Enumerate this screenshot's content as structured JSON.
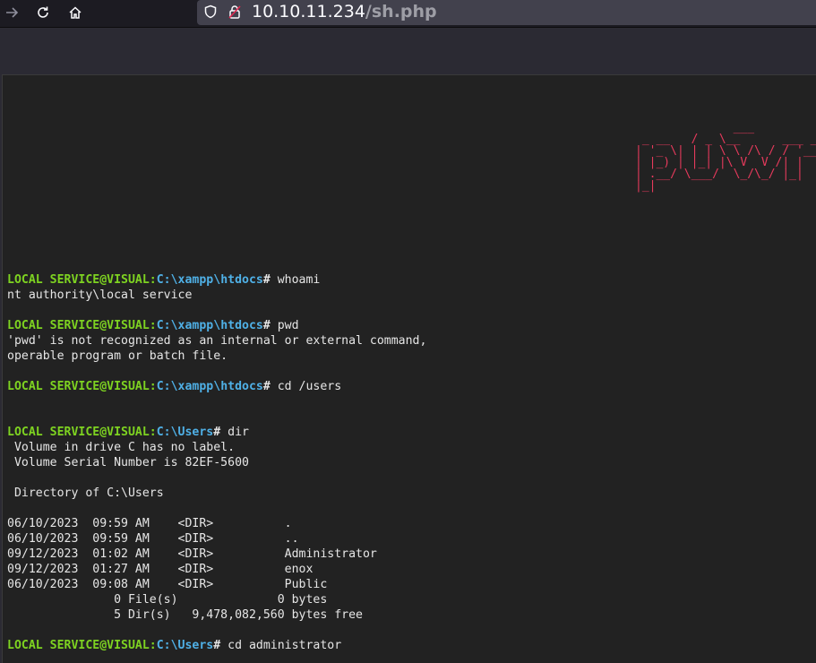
{
  "browser": {
    "icons": [
      "back-arrow-icon",
      "reload-icon",
      "home-icon",
      "shield-icon",
      "insecure-lock-icon"
    ],
    "url_host": "10.10.11.234",
    "url_path": "/sh.php"
  },
  "terminal": {
    "banner_ascii": "              ___\n _ __   / _ \\__      ___ __\n| '_ \\| | | \\ \\ /\\ / / '__\n| |_) | |_| |\\ V  V /| |\n| .__/ \\___/  \\_/\\_/ |_|\n|_|",
    "accent_color": "#e63a5c",
    "lines": [
      {
        "kind": "prompt",
        "user": "LOCAL SERVICE@VISUAL:",
        "path": "C:\\xampp\\htdocs",
        "symbol": "#",
        "command": " whoami"
      },
      {
        "kind": "output",
        "text": "nt authority\\local service"
      },
      {
        "kind": "blank",
        "text": ""
      },
      {
        "kind": "prompt",
        "user": "LOCAL SERVICE@VISUAL:",
        "path": "C:\\xampp\\htdocs",
        "symbol": "#",
        "command": " pwd"
      },
      {
        "kind": "output",
        "text": "'pwd' is not recognized as an internal or external command,"
      },
      {
        "kind": "output",
        "text": "operable program or batch file."
      },
      {
        "kind": "blank",
        "text": ""
      },
      {
        "kind": "prompt",
        "user": "LOCAL SERVICE@VISUAL:",
        "path": "C:\\xampp\\htdocs",
        "symbol": "#",
        "command": " cd /users"
      },
      {
        "kind": "blank",
        "text": ""
      },
      {
        "kind": "blank",
        "text": ""
      },
      {
        "kind": "prompt",
        "user": "LOCAL SERVICE@VISUAL:",
        "path": "C:\\Users",
        "symbol": "#",
        "command": " dir"
      },
      {
        "kind": "output",
        "text": " Volume in drive C has no label."
      },
      {
        "kind": "output",
        "text": " Volume Serial Number is 82EF-5600"
      },
      {
        "kind": "blank",
        "text": ""
      },
      {
        "kind": "output",
        "text": " Directory of C:\\Users"
      },
      {
        "kind": "blank",
        "text": ""
      },
      {
        "kind": "output",
        "text": "06/10/2023  09:59 AM    <DIR>          ."
      },
      {
        "kind": "output",
        "text": "06/10/2023  09:59 AM    <DIR>          .."
      },
      {
        "kind": "output",
        "text": "09/12/2023  01:02 AM    <DIR>          Administrator"
      },
      {
        "kind": "output",
        "text": "09/12/2023  01:27 AM    <DIR>          enox"
      },
      {
        "kind": "output",
        "text": "06/10/2023  09:08 AM    <DIR>          Public"
      },
      {
        "kind": "output",
        "text": "               0 File(s)              0 bytes"
      },
      {
        "kind": "output",
        "text": "               5 Dir(s)   9,478,082,560 bytes free"
      },
      {
        "kind": "blank",
        "text": ""
      },
      {
        "kind": "prompt",
        "user": "LOCAL SERVICE@VISUAL:",
        "path": "C:\\Users",
        "symbol": "#",
        "command": " cd administrator"
      }
    ]
  }
}
